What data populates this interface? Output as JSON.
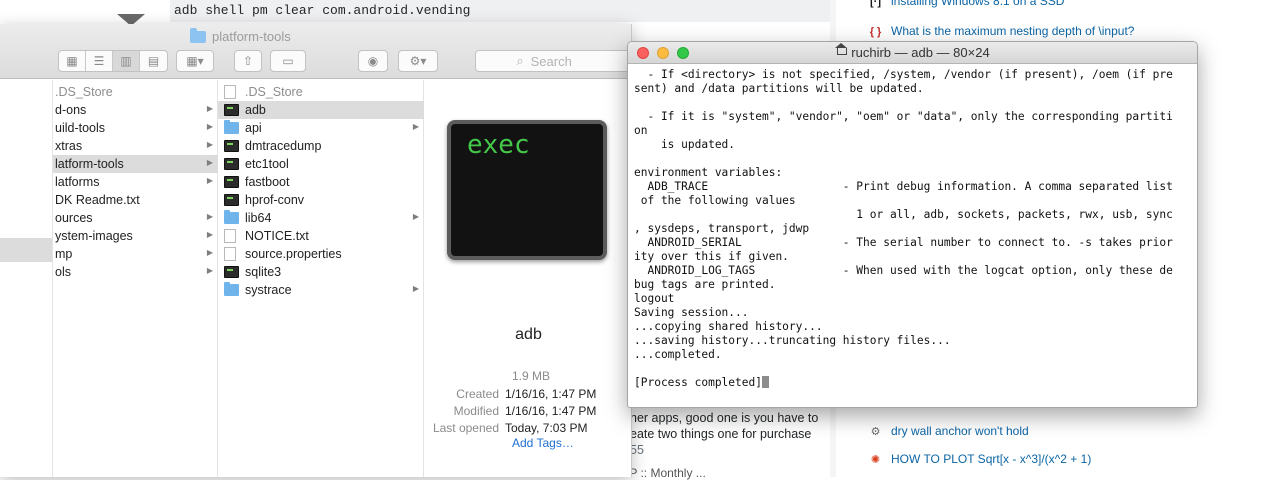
{
  "background": {
    "code_line": "adb shell pm clear com.android.vending",
    "answer_text_lines": [
      "her apps, good one is you have to",
      "eate two things one for purchase",
      "55"
    ],
    "bottom_text": "OP :: Monthly ...",
    "hot_questions": [
      {
        "icon": "bracket-icon",
        "icon_glyph": "[·]",
        "icon_color": "#1a1a1a",
        "label": "installing Windows 8.1 on a SSD"
      },
      {
        "icon": "braces-icon",
        "icon_glyph": "{ }",
        "icon_color": "#c4302b",
        "label": "What is the maximum nesting depth of \\input?"
      },
      {
        "icon": "gear-icon",
        "icon_glyph": "⚙",
        "icon_color": "#6b6b6b",
        "label": "dry wall anchor won't hold"
      },
      {
        "icon": "mathematica-icon",
        "icon_glyph": "✺",
        "icon_color": "#d9411e",
        "label": "HOW TO PLOT Sqrt[x - x^3]/(x^2 + 1)"
      }
    ]
  },
  "finder": {
    "title": "platform-tools",
    "search_placeholder": "Search",
    "column1": [
      {
        "label": ".DS_Store",
        "dim": true,
        "chevron": false
      },
      {
        "label": "d-ons",
        "dim": false,
        "chevron": true
      },
      {
        "label": "uild-tools",
        "dim": false,
        "chevron": true
      },
      {
        "label": "xtras",
        "dim": false,
        "chevron": true
      },
      {
        "label": "latform-tools",
        "dim": false,
        "chevron": true,
        "selected": true
      },
      {
        "label": "latforms",
        "dim": false,
        "chevron": true
      },
      {
        "label": "DK Readme.txt",
        "dim": false,
        "chevron": false
      },
      {
        "label": "ources",
        "dim": false,
        "chevron": true
      },
      {
        "label": "ystem-images",
        "dim": false,
        "chevron": true
      },
      {
        "label": "mp",
        "dim": false,
        "chevron": true
      },
      {
        "label": "ols",
        "dim": false,
        "chevron": true
      }
    ],
    "column2": [
      {
        "label": ".DS_Store",
        "type": "doc",
        "dim": true,
        "chevron": false
      },
      {
        "label": "adb",
        "type": "exec",
        "chevron": false,
        "selected": true
      },
      {
        "label": "api",
        "type": "folder",
        "chevron": true
      },
      {
        "label": "dmtracedump",
        "type": "exec",
        "chevron": false
      },
      {
        "label": "etc1tool",
        "type": "exec",
        "chevron": false
      },
      {
        "label": "fastboot",
        "type": "exec",
        "chevron": false
      },
      {
        "label": "hprof-conv",
        "type": "exec",
        "chevron": false
      },
      {
        "label": "lib64",
        "type": "folder",
        "chevron": true
      },
      {
        "label": "NOTICE.txt",
        "type": "doc",
        "chevron": false
      },
      {
        "label": "source.properties",
        "type": "doc",
        "chevron": false
      },
      {
        "label": "sqlite3",
        "type": "exec",
        "chevron": false
      },
      {
        "label": "systrace",
        "type": "folder",
        "chevron": true
      }
    ],
    "preview": {
      "icon_text": "exec",
      "name": "adb",
      "size": "1.9 MB",
      "meta": [
        {
          "key": "Created",
          "value": "1/16/16, 1:47 PM"
        },
        {
          "key": "Modified",
          "value": "1/16/16, 1:47 PM"
        },
        {
          "key": "Last opened",
          "value": "Today, 7:03 PM"
        }
      ],
      "add_tags": "Add Tags…"
    }
  },
  "terminal": {
    "title": "ruchirb — adb — 80×24",
    "lines": [
      "  - If <directory> is not specified, /system, /vendor (if present), /oem (if pre",
      "sent) and /data partitions will be updated.",
      "",
      "  - If it is \"system\", \"vendor\", \"oem\" or \"data\", only the corresponding partiti",
      "on",
      "    is updated.",
      "",
      "environment variables:",
      "  ADB_TRACE                    - Print debug information. A comma separated list",
      " of the following values",
      "                                 1 or all, adb, sockets, packets, rwx, usb, sync",
      ", sysdeps, transport, jdwp",
      "  ANDROID_SERIAL               - The serial number to connect to. -s takes prior",
      "ity over this if given.",
      "  ANDROID_LOG_TAGS             - When used with the logcat option, only these de",
      "bug tags are printed.",
      "logout",
      "Saving session...",
      "...copying shared history...",
      "...saving history...truncating history files...",
      "...completed.",
      "",
      "[Process completed]"
    ]
  }
}
